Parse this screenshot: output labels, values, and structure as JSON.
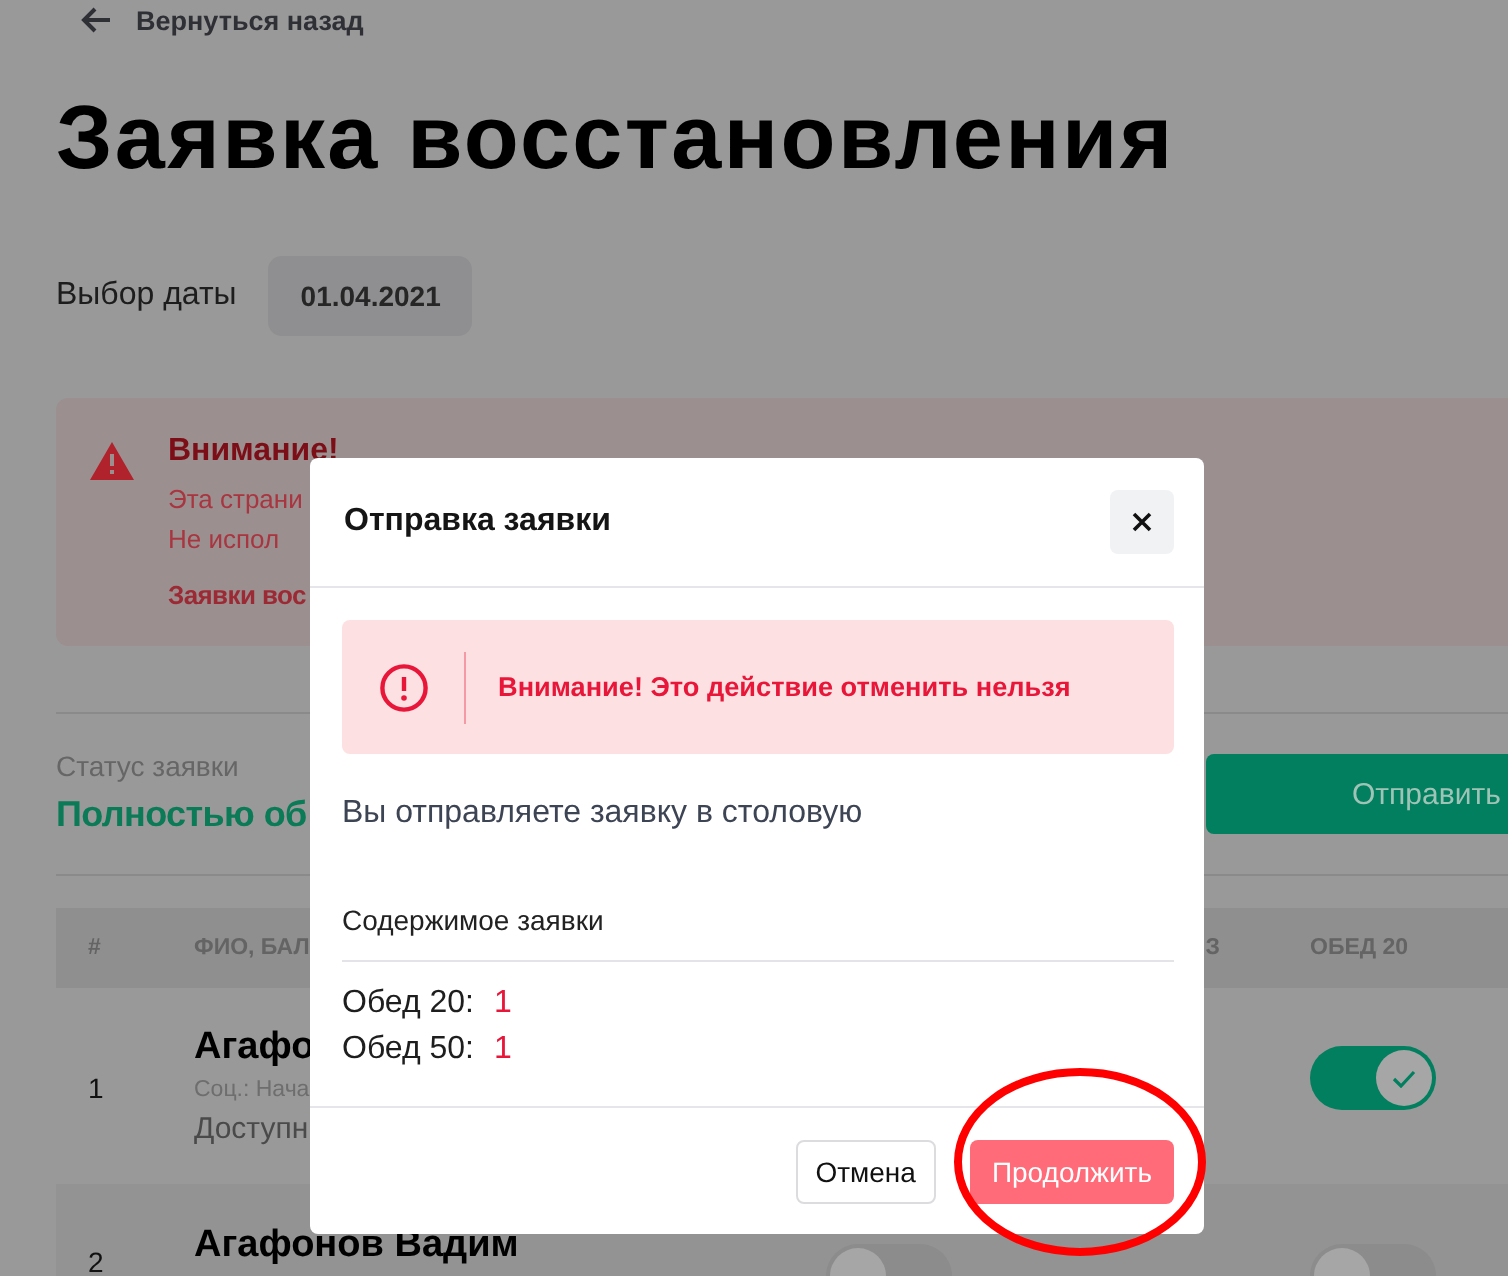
{
  "back_link": {
    "label": "Вернуться назад"
  },
  "title": "Заявка восстановления",
  "date_picker": {
    "label": "Выбор даты",
    "value": "01.04.2021"
  },
  "warning": {
    "title": "Внимание!",
    "lines": [
      "Эта страни",
      "Не испол"
    ],
    "link": "Заявки вос"
  },
  "status": {
    "label": "Статус заявки",
    "value": "Полностью об"
  },
  "send_button": {
    "label": "Отправить"
  },
  "table": {
    "columns": [
      "#",
      "ФИО, БАЛ",
      "З",
      "ОБЕД 20"
    ],
    "rows": [
      {
        "number": "1",
        "name": "Агафо",
        "subtitle": "Соц.: Нача",
        "note": "Доступн",
        "toggle_obed_20": {
          "on": true
        }
      },
      {
        "number": "2",
        "name": "Агафонов Вадим",
        "toggle_column_3": {
          "on": false
        },
        "toggle_obed_20": {
          "on": false
        }
      }
    ]
  },
  "dialog": {
    "title": "Отправка заявки",
    "alert": "Внимание! Это действие отменить нельзя",
    "message": "Вы отправляете заявку в столовую",
    "contents_title": "Содержимое заявки",
    "items": [
      {
        "label": "Обед 20:",
        "value": "1"
      },
      {
        "label": "Обед 50:",
        "value": "1"
      }
    ],
    "buttons": [
      {
        "label": "Отмена",
        "kind": "secondary"
      },
      {
        "label": "Продолжить",
        "kind": "primary"
      }
    ]
  },
  "annotations": [
    {
      "kind": "ellipse"
    }
  ]
}
